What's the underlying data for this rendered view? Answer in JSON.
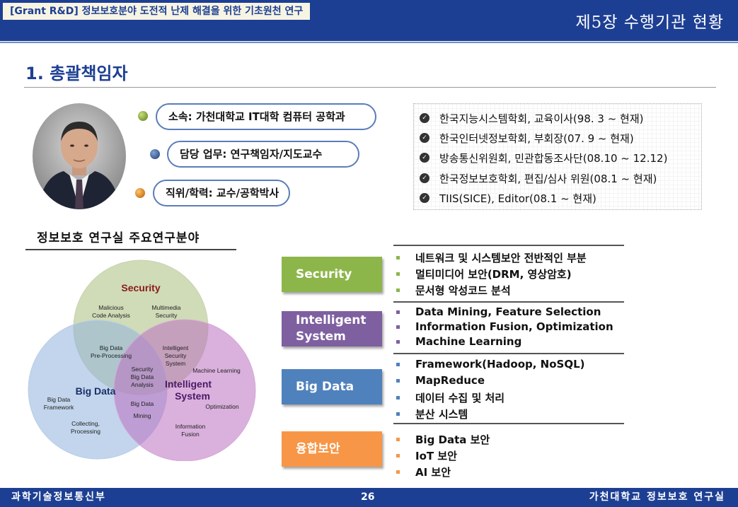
{
  "header": {
    "grant_tag": "[Grant R&D] 정보보호분야 도전적 난제 해결을 위한 기초원천 연구",
    "chapter": "제5장 수행기관 현황"
  },
  "page_title": "1. 총괄책임자",
  "profile": {
    "affiliation": "소속: 가천대학교 IT대학 컴퓨터 공학과",
    "duty": "담당 업무: 연구책임자/지도교수",
    "position": "직위/학력: 교수/공학박사"
  },
  "career": [
    "한국지능시스템학회, 교육이사(98. 3 ~ 현재)",
    "한국인터넷정보학회, 부회장(07. 9 ~ 현재)",
    "방송통신위원회, 민관합동조사단(08.10 ~ 12.12)",
    "한국정보보호학회, 편집/심사 위원(08.1 ~ 현재)",
    "TIIS(SICE), Editor(08.1 ~ 현재)"
  ],
  "section_label": "정보보호 연구실 주요연구분야",
  "venn": {
    "security": "Security",
    "malicious_1": "Malicious",
    "malicious_2": "Code Analysis",
    "multimedia_1": "Multimedia",
    "multimedia_2": "Security",
    "bigdata": "Big Data",
    "preproc_1": "Big Data",
    "preproc_2": "Pre-Processing",
    "intsec_1": "Intelligent",
    "intsec_2": "Security",
    "intsec_3": "System",
    "center_1": "Security",
    "center_2": "Big Data",
    "center_3": "Analysis",
    "intelligent_1": "Intelligent",
    "intelligent_2": "System",
    "machine": "Machine Learning",
    "optimization": "Optimization",
    "framework_1": "Big Data",
    "framework_2": "Framework",
    "collect_1": "Collecting,",
    "collect_2": "Processing",
    "mining_1": "Big Data",
    "mining_2": "Mining",
    "fusion_1": "Information",
    "fusion_2": "Fusion"
  },
  "categories": [
    {
      "label": "Security",
      "color": "#8db64a",
      "items": [
        "네트워크 및 시스템보안 전반적인 부분",
        "멀티미디어 보안(DRM, 영상암호)",
        "문서형 악성코드 분석"
      ]
    },
    {
      "label_1": "Intelligent",
      "label_2": "System",
      "color": "#7e60a0",
      "items": [
        "Data Mining, Feature Selection",
        "Information Fusion, Optimization",
        "Machine Learning"
      ]
    },
    {
      "label": "Big Data",
      "color": "#4f81bd",
      "items": [
        "Framework(Hadoop, NoSQL)",
        "MapReduce",
        "데이터 수집 및 처리",
        "분산 시스템"
      ]
    },
    {
      "label": "융합보안",
      "color": "#f79646",
      "items": [
        "Big Data 보안",
        "IoT 보안",
        "AI 보안"
      ]
    }
  ],
  "footer": {
    "left": "과학기술정보통신부",
    "page": "26",
    "right": "가천대학교 정보보호 연구실"
  }
}
